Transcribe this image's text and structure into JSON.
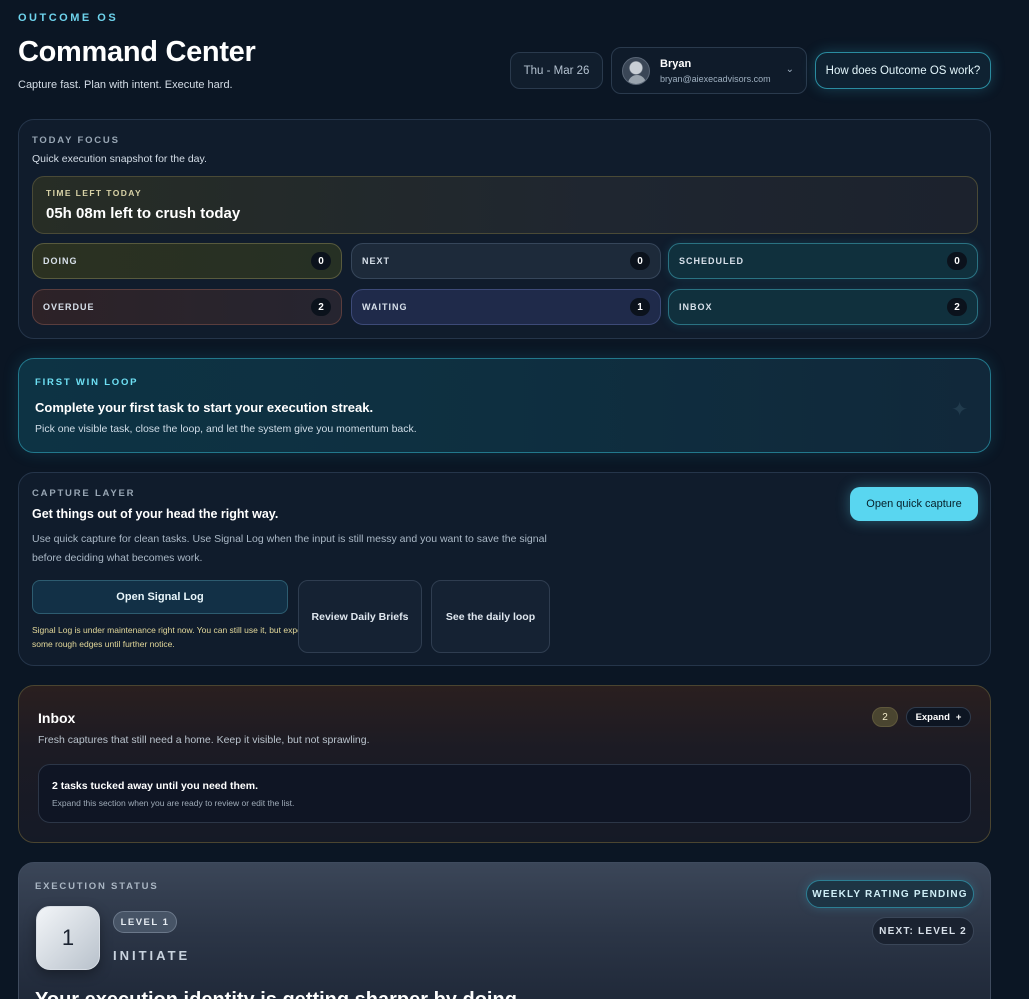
{
  "header": {
    "brand": "OUTCOME OS",
    "title": "Command Center",
    "subtitle": "Capture fast. Plan with intent. Execute hard.",
    "date": "Thu - Mar 26",
    "user": {
      "name": "Bryan",
      "email": "bryan@aiexecadvisors.com"
    },
    "help_button": "How does Outcome OS work?"
  },
  "today_focus": {
    "label": "TODAY FOCUS",
    "subtitle": "Quick execution snapshot for the day.",
    "time_left_label": "TIME LEFT TODAY",
    "time_left_value": "05h 08m left to crush today",
    "stats": {
      "doing": {
        "label": "DOING",
        "count": "0"
      },
      "next": {
        "label": "NEXT",
        "count": "0"
      },
      "scheduled": {
        "label": "SCHEDULED",
        "count": "0"
      },
      "overdue": {
        "label": "OVERDUE",
        "count": "2"
      },
      "waiting": {
        "label": "WAITING",
        "count": "1"
      },
      "inbox": {
        "label": "INBOX",
        "count": "2"
      }
    }
  },
  "first_win": {
    "label": "FIRST WIN LOOP",
    "title": "Complete your first task to start your execution streak.",
    "subtitle": "Pick one visible task, close the loop, and let the system give you momentum back."
  },
  "capture": {
    "label": "CAPTURE LAYER",
    "title": "Get things out of your head the right way.",
    "description": "Use quick capture for clean tasks. Use Signal Log when the input is still messy and you want to save the signal before deciding what becomes work.",
    "quick_capture_button": "Open quick capture",
    "signal_log_button": "Open Signal Log",
    "signal_note": "Signal Log is under maintenance right now. You can still use it, but expect some rough edges until further notice.",
    "review_briefs_button": "Review Daily Briefs",
    "daily_loop_button": "See the daily loop"
  },
  "inbox": {
    "title": "Inbox",
    "subtitle": "Fresh captures that still need a home. Keep it visible, but not sprawling.",
    "count": "2",
    "expand_label": "Expand",
    "expand_icon": "+",
    "tucked_title": "2 tasks tucked away until you need them.",
    "tucked_subtitle": "Expand this section when you are ready to review or edit the list."
  },
  "execution": {
    "label": "EXECUTION STATUS",
    "level_number": "1",
    "level_badge": "LEVEL 1",
    "level_name": "INITIATE",
    "weekly_pill": "WEEKLY RATING PENDING",
    "next_pill": "NEXT: LEVEL 2",
    "heading": "Your execution identity is getting sharper by doing."
  }
}
